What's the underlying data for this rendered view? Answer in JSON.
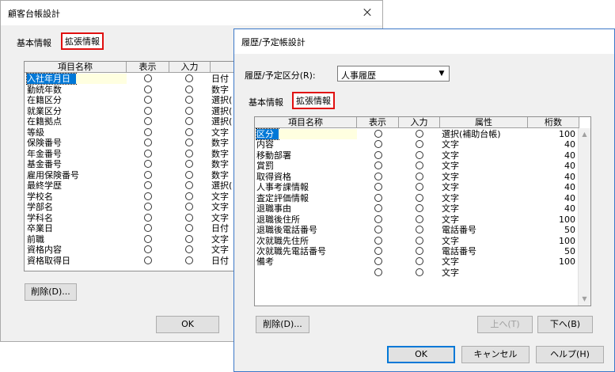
{
  "back": {
    "title": "顧客台帳設計",
    "tab_basic": "基本情報",
    "tab_ext": "拡張情報",
    "headers": [
      "項目名称",
      "表示",
      "入力",
      ""
    ],
    "rows": [
      {
        "name": "入社年月日",
        "attr": "日付"
      },
      {
        "name": "勤続年数",
        "attr": "数字"
      },
      {
        "name": "在籍区分",
        "attr": "選択("
      },
      {
        "name": "就業区分",
        "attr": "選択("
      },
      {
        "name": "在籍拠点",
        "attr": "選択("
      },
      {
        "name": "等級",
        "attr": "文字"
      },
      {
        "name": "保険番号",
        "attr": "数字"
      },
      {
        "name": "年金番号",
        "attr": "数字"
      },
      {
        "name": "基金番号",
        "attr": "数字"
      },
      {
        "name": "雇用保険番号",
        "attr": "数字"
      },
      {
        "name": "最終学歴",
        "attr": "選択("
      },
      {
        "name": "学校名",
        "attr": "文字"
      },
      {
        "name": "学部名",
        "attr": "文字"
      },
      {
        "name": "学科名",
        "attr": "文字"
      },
      {
        "name": "卒業日",
        "attr": "日付"
      },
      {
        "name": "前職",
        "attr": "文字"
      },
      {
        "name": "資格内容",
        "attr": "文字"
      },
      {
        "name": "資格取得日",
        "attr": "日付"
      }
    ],
    "delete_label": "削除(D)...",
    "ok_label": "OK"
  },
  "front": {
    "title": "履歴/予定帳設計",
    "type_label": "履歴/予定区分(R):",
    "type_value": "人事履歴",
    "tab_basic": "基本情報",
    "tab_ext": "拡張情報",
    "headers": [
      "項目名称",
      "表示",
      "入力",
      "属性",
      "桁数"
    ],
    "rows": [
      {
        "name": "区分",
        "attr": "選択(補助台帳)",
        "digits": "100"
      },
      {
        "name": "内容",
        "attr": "文字",
        "digits": "40"
      },
      {
        "name": "移動部署",
        "attr": "文字",
        "digits": "40"
      },
      {
        "name": "賞罰",
        "attr": "文字",
        "digits": "40"
      },
      {
        "name": "取得資格",
        "attr": "文字",
        "digits": "40"
      },
      {
        "name": "人事考課情報",
        "attr": "文字",
        "digits": "40"
      },
      {
        "name": "査定評価情報",
        "attr": "文字",
        "digits": "40"
      },
      {
        "name": "退職事由",
        "attr": "文字",
        "digits": "40"
      },
      {
        "name": "退職後住所",
        "attr": "文字",
        "digits": "100"
      },
      {
        "name": "退職後電話番号",
        "attr": "電話番号",
        "digits": "50"
      },
      {
        "name": "次就職先住所",
        "attr": "文字",
        "digits": "100"
      },
      {
        "name": "次就職先電話番号",
        "attr": "電話番号",
        "digits": "50"
      },
      {
        "name": "備考",
        "attr": "文字",
        "digits": "100"
      },
      {
        "name": "",
        "attr": "文字",
        "digits": ""
      }
    ],
    "delete_label": "削除(D)...",
    "up_label": "上へ(T)",
    "down_label": "下へ(B)",
    "ok_label": "OK",
    "cancel_label": "キャンセル",
    "help_label": "ヘルプ(H)"
  },
  "colors": {
    "selection": "#0078d7",
    "tab_highlight": "#e01010",
    "dialog_bg": "#f0f0f0"
  }
}
